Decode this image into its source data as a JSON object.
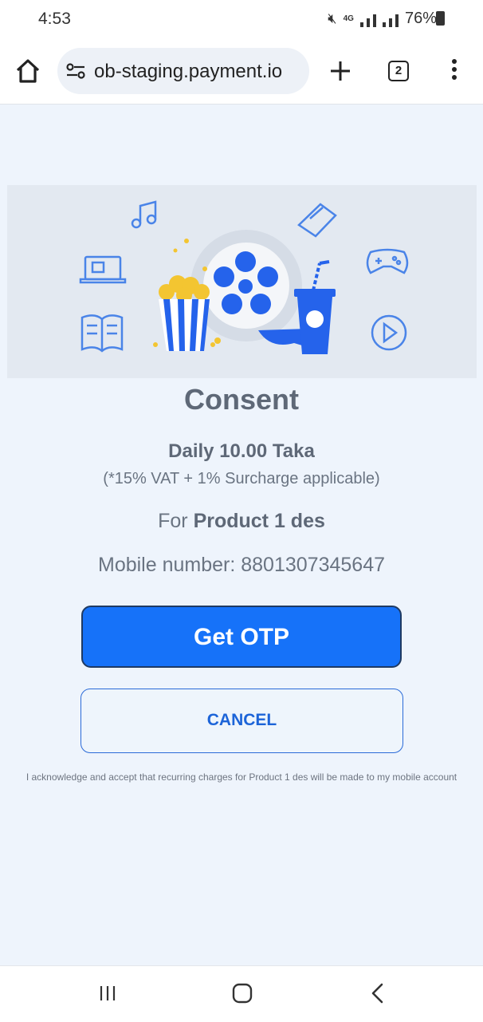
{
  "status_bar": {
    "time": "4:53",
    "network": "4G",
    "battery": "76%"
  },
  "browser": {
    "url": "ob-staging.payment.io",
    "tab_count": "2"
  },
  "consent": {
    "title": "Consent",
    "price": "Daily 10.00 Taka",
    "vat_note": "(*15% VAT + 1% Surcharge applicable)",
    "product_prefix": "For ",
    "product_name": "Product 1 des",
    "mobile_label": "Mobile number: ",
    "mobile_number": "8801307345647",
    "otp_button": "Get OTP",
    "cancel_button": "CANCEL",
    "acknowledgement": "I acknowledge and accept that recurring charges for Product 1 des will be made to my mobile account"
  },
  "colors": {
    "primary": "#1672f9",
    "cancel_text": "#1c64d8",
    "page_bg": "#eef4fc",
    "banner_bg": "#e3e9f1"
  },
  "icons": [
    "home-icon",
    "site-settings-icon",
    "plus-icon",
    "tabs-icon",
    "more-vert-icon",
    "music-note-icon",
    "ticket-icon",
    "laptop-icon",
    "gamepad-icon",
    "book-icon",
    "popcorn-icon",
    "film-reel-icon",
    "drink-cup-icon",
    "play-circle-icon",
    "recents-icon",
    "home-nav-icon",
    "back-icon"
  ]
}
